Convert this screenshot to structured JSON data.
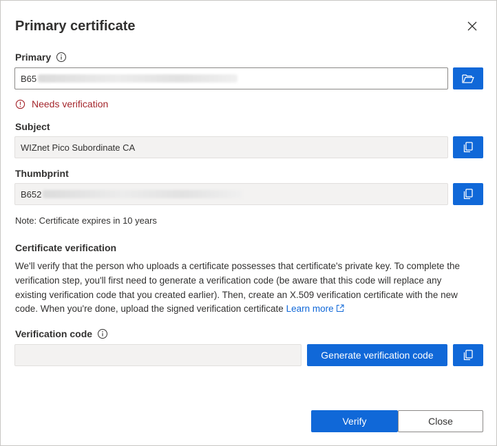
{
  "dialog": {
    "title": "Primary certificate"
  },
  "primary": {
    "label": "Primary",
    "value_prefix": "B65",
    "error": "Needs verification"
  },
  "subject": {
    "label": "Subject",
    "value": "WIZnet Pico Subordinate CA"
  },
  "thumbprint": {
    "label": "Thumbprint",
    "value_prefix": "B652"
  },
  "note": "Note: Certificate expires in 10 years",
  "verification": {
    "title": "Certificate verification",
    "line1": "We'll verify that the person who uploads a certificate possesses that certificate's private key. To complete the",
    "line2": "verification step, you'll first need to generate a verification code (be aware that this code will replace any",
    "line3": "existing verification code that you created earlier). Then, create an X.509 verification certificate with the new",
    "line4": "code. When you're done, upload the signed verification certificate ",
    "learn_more": "Learn more"
  },
  "verification_code": {
    "label": "Verification code",
    "value": "",
    "generate_label": "Generate verification code"
  },
  "footer": {
    "verify_label": "Verify",
    "close_label": "Close"
  },
  "colors": {
    "accent": "#1068d8",
    "error": "#a4262c"
  },
  "icons": [
    "close-icon",
    "info-icon",
    "folder-open-icon",
    "error-circle-icon",
    "copy-icon",
    "external-link-icon"
  ]
}
